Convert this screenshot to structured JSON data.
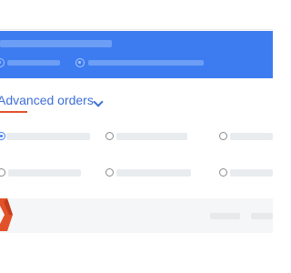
{
  "section": {
    "title": "Advanced orders",
    "expand_icon": "chevron-down-icon"
  },
  "options": {
    "row1_selected": "first"
  },
  "brand": {
    "logo_icon": "brand-logo-icon",
    "accent_color": "#e2522a",
    "primary_color": "#3d7cf0"
  }
}
